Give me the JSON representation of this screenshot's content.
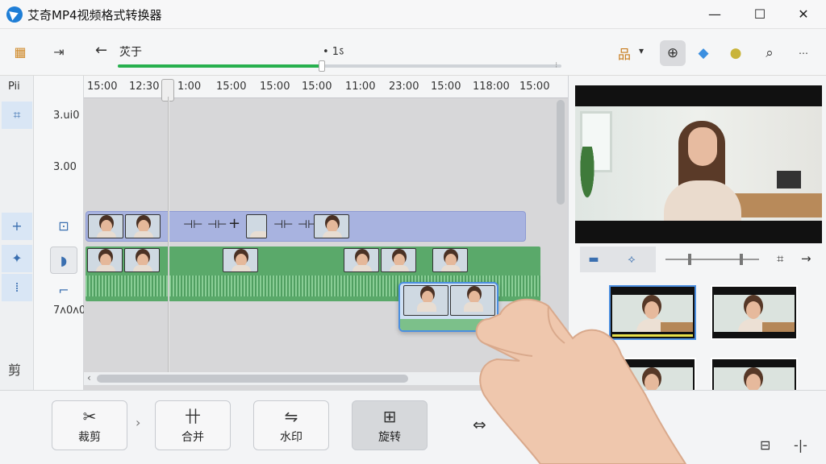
{
  "window": {
    "title": "艾奇MP4视频格式转换器",
    "minimize": "—",
    "maximize": "☐",
    "close": "✕"
  },
  "toolbar": {
    "back": "←",
    "breadcrumb": "苂于",
    "progress_label": "• 1ऽ",
    "progress_percent": 46,
    "grid_label": "品",
    "grid_caret": "▾"
  },
  "rail": {
    "top_label": "Pii",
    "bottom_label": "剪"
  },
  "track_values": {
    "v1": "3.ui0",
    "v2": "3.00",
    "v3": "7ʌ0ʌ0"
  },
  "ruler": {
    "ticks": [
      "15:00",
      "12:30",
      "1:00",
      "15:00",
      "15:00",
      "15:00",
      "11:00",
      "23:00",
      "15:00",
      "118:00",
      "15:00"
    ]
  },
  "markers": [
    "+",
    "⊣⊢",
    "⊣⊢",
    "⊣⊢"
  ],
  "bottom_tools": [
    {
      "label": "裁剪",
      "icon": "✂"
    },
    {
      "label": "合并",
      "icon": "卄"
    },
    {
      "label": "水印",
      "icon": "⇋"
    },
    {
      "label": "旋转",
      "icon": "⊞"
    }
  ],
  "icons": {
    "app": "app-logo-icon",
    "swap": "⇔",
    "chev": "›",
    "arrow_right": "→",
    "crop": "⌗",
    "bottom_right_1": "⊟",
    "bottom_right_2": "-|-"
  }
}
